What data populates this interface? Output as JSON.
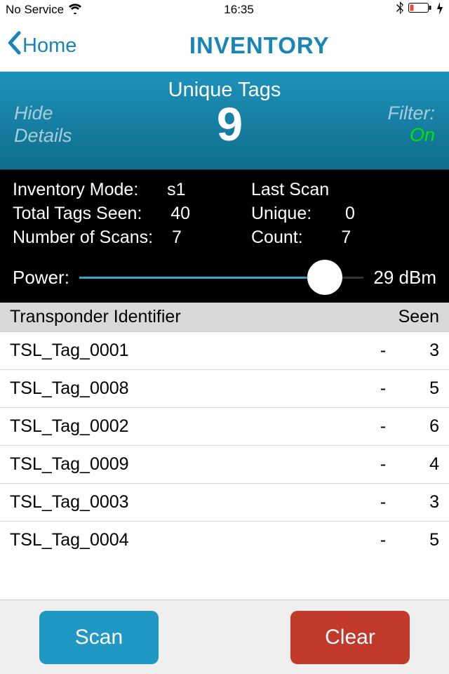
{
  "status_bar": {
    "service": "No Service",
    "time": "16:35"
  },
  "nav": {
    "back_label": "Home",
    "title": "INVENTORY"
  },
  "banner": {
    "title": "Unique Tags",
    "hide_details": "Hide\nDetails",
    "count": "9",
    "filter_label": "Filter:",
    "filter_value": "On"
  },
  "details": {
    "inventory_mode_label": "Inventory Mode:",
    "inventory_mode_value": "s1",
    "total_tags_label": "Total Tags Seen:",
    "total_tags_value": "40",
    "scans_label": "Number of Scans:",
    "scans_value": "7",
    "last_scan_label": "Last Scan",
    "unique_label": "Unique:",
    "unique_value": "0",
    "count_label": "Count:",
    "count_value": "7"
  },
  "power": {
    "label": "Power:",
    "value": "29 dBm"
  },
  "list_header": {
    "id_label": "Transponder Identifier",
    "seen_label": "Seen"
  },
  "rows": [
    {
      "id": "TSL_Tag_0001",
      "dash": "-",
      "seen": "3"
    },
    {
      "id": "TSL_Tag_0008",
      "dash": "-",
      "seen": "5"
    },
    {
      "id": "TSL_Tag_0002",
      "dash": "-",
      "seen": "6"
    },
    {
      "id": "TSL_Tag_0009",
      "dash": "-",
      "seen": "4"
    },
    {
      "id": "TSL_Tag_0003",
      "dash": "-",
      "seen": "3"
    },
    {
      "id": "TSL_Tag_0004",
      "dash": "-",
      "seen": "5"
    }
  ],
  "buttons": {
    "scan": "Scan",
    "clear": "Clear"
  }
}
